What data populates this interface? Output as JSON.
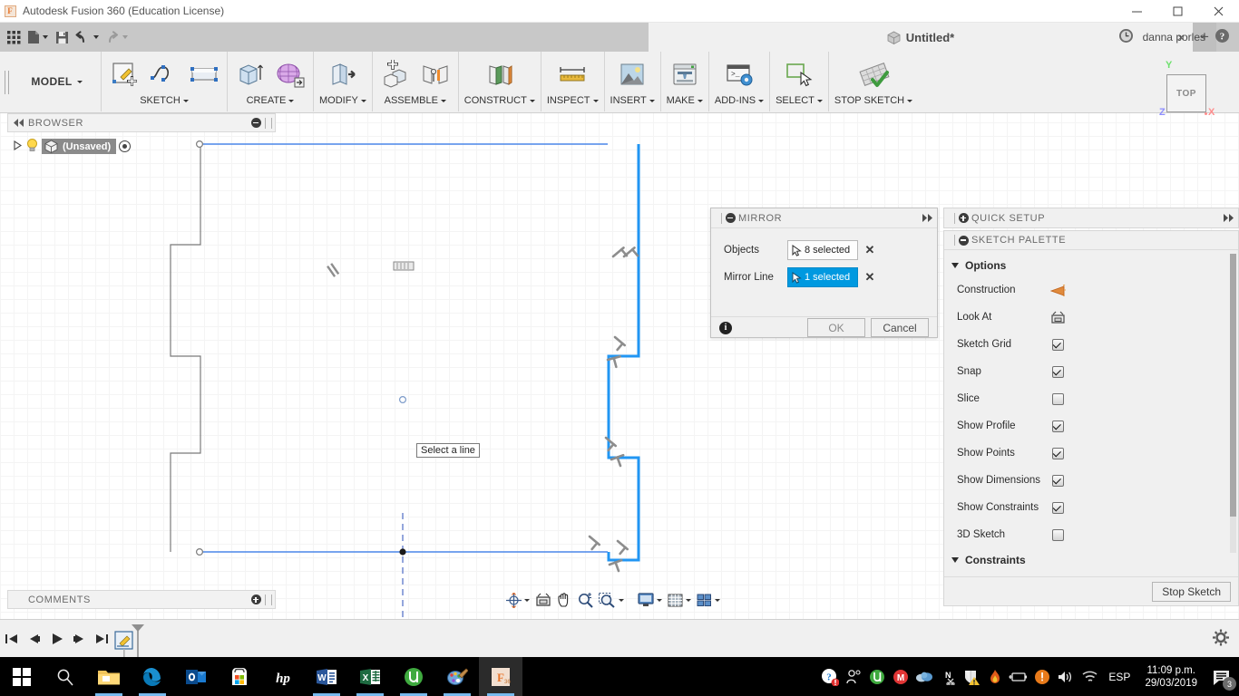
{
  "window": {
    "app_title": "Autodesk Fusion 360 (Education License)",
    "logo_glyph": "F",
    "minimize_icon": "minimize-icon",
    "maximize_icon": "maximize-icon",
    "close_icon": "close-icon"
  },
  "quick_access": {
    "grid_icon": "app-grid-icon",
    "new_icon": "new-document-icon",
    "save_icon": "save-icon",
    "undo_icon": "undo-icon",
    "redo_icon": "redo-icon",
    "document_tab": "Untitled*",
    "document_icon": "cube-icon",
    "tab_close": "×",
    "tab_new": "+",
    "recent_icon": "clock-icon",
    "username": "danna porles",
    "help_icon": "help-icon"
  },
  "ribbon": {
    "workspace": "MODEL",
    "groups": [
      {
        "label": "SKETCH",
        "icons": [
          "create-sketch-icon",
          "spline-icon",
          "rectangle-icon"
        ]
      },
      {
        "label": "CREATE",
        "icons": [
          "extrude-icon",
          "create-form-icon"
        ]
      },
      {
        "label": "MODIFY",
        "icons": [
          "press-pull-icon"
        ]
      },
      {
        "label": "ASSEMBLE",
        "icons": [
          "new-component-icon",
          "joint-icon"
        ]
      },
      {
        "label": "CONSTRUCT",
        "icons": [
          "offset-plane-icon"
        ]
      },
      {
        "label": "INSPECT",
        "icons": [
          "measure-icon"
        ]
      },
      {
        "label": "INSERT",
        "icons": [
          "insert-image-icon"
        ]
      },
      {
        "label": "MAKE",
        "icons": [
          "3d-print-icon"
        ]
      },
      {
        "label": "ADD-INS",
        "icons": [
          "scripts-addins-icon"
        ]
      },
      {
        "label": "SELECT",
        "icons": [
          "select-icon"
        ]
      },
      {
        "label": "STOP SKETCH",
        "icons": [
          "stop-sketch-icon"
        ]
      }
    ]
  },
  "browser": {
    "title": "BROWSER",
    "collapse_icon": "collapse-left-icon",
    "minus_icon": "minus-circle-icon",
    "root": {
      "expand_icon": "triangle-right-icon",
      "bulb_icon": "lightbulb-icon",
      "component_icon": "component-icon",
      "label": "(Unsaved)",
      "radio_icon": "radio-selected-icon"
    }
  },
  "comments": {
    "title": "COMMENTS",
    "plus_icon": "plus-circle-icon"
  },
  "viewcube": {
    "face_label": "TOP",
    "axis_y": "Y",
    "axis_x": "X",
    "axis_z": "Z"
  },
  "canvas": {
    "tooltip": "Select a line",
    "grid_minor_color": "#f4f4f4",
    "grid_major_color": "#dcdcdc",
    "selection_color": "#2196f3",
    "profile_color": "#4a86e8",
    "geometry_color": "#7b7b7b",
    "construction_color": "#5b77c9"
  },
  "mirror_dialog": {
    "title": "MIRROR",
    "grip_icon": "drag-grip-icon",
    "minimize_icon": "minus-circle-icon",
    "expand_icon": "expand-right-icon",
    "rows": [
      {
        "label": "Objects",
        "value": "8 selected",
        "cursor_icon": "select-cursor-icon",
        "clear_icon": "✕",
        "active": false
      },
      {
        "label": "Mirror Line",
        "value": "1 selected",
        "cursor_icon": "select-cursor-icon",
        "clear_icon": "✕",
        "active": true
      }
    ],
    "info_icon": "info-icon",
    "ok_label": "OK",
    "cancel_label": "Cancel"
  },
  "quick_setup": {
    "title": "QUICK SETUP",
    "plus_icon": "plus-circle-icon",
    "expand_icon": "expand-right-icon",
    "grip_icon": "drag-grip-icon"
  },
  "sketch_palette": {
    "title": "SKETCH PALETTE",
    "minimize_icon": "minus-circle-icon",
    "grip_icon": "drag-grip-icon",
    "options_section": "Options",
    "constraints_section": "Constraints",
    "options": [
      {
        "label": "Construction",
        "control": "icon",
        "icon": "construction-line-icon",
        "checked": null
      },
      {
        "label": "Look At",
        "control": "icon",
        "icon": "look-at-icon",
        "checked": null
      },
      {
        "label": "Sketch Grid",
        "control": "checkbox",
        "icon": "checkbox-icon",
        "checked": true
      },
      {
        "label": "Snap",
        "control": "checkbox",
        "icon": "checkbox-icon",
        "checked": true
      },
      {
        "label": "Slice",
        "control": "checkbox",
        "icon": "checkbox-icon",
        "checked": false
      },
      {
        "label": "Show Profile",
        "control": "checkbox",
        "icon": "checkbox-icon",
        "checked": true
      },
      {
        "label": "Show Points",
        "control": "checkbox",
        "icon": "checkbox-icon",
        "checked": true
      },
      {
        "label": "Show Dimensions",
        "control": "checkbox",
        "icon": "checkbox-icon",
        "checked": true
      },
      {
        "label": "Show Constraints",
        "control": "checkbox",
        "icon": "checkbox-icon",
        "checked": true
      },
      {
        "label": "3D Sketch",
        "control": "checkbox",
        "icon": "checkbox-icon",
        "checked": false
      }
    ],
    "stop_sketch_label": "Stop Sketch"
  },
  "nav_bar": {
    "items": [
      {
        "icon": "orbit-icon",
        "has_caret": true
      },
      {
        "icon": "look-at-icon",
        "has_caret": false
      },
      {
        "icon": "pan-icon",
        "has_caret": false
      },
      {
        "icon": "zoom-icon",
        "has_caret": false
      },
      {
        "icon": "zoom-window-icon",
        "has_caret": true
      },
      {
        "icon": "display-settings-icon",
        "has_caret": true
      },
      {
        "icon": "grid-snaps-icon",
        "has_caret": true
      },
      {
        "icon": "viewports-icon",
        "has_caret": true
      }
    ]
  },
  "timeline": {
    "buttons": [
      {
        "icon": "go-to-beginning-icon"
      },
      {
        "icon": "step-back-icon"
      },
      {
        "icon": "play-icon"
      },
      {
        "icon": "step-forward-icon"
      },
      {
        "icon": "go-to-end-icon"
      }
    ],
    "feature_icon": "sketch-feature-icon",
    "settings_icon": "gear-icon"
  },
  "taskbar": {
    "start_icon": "windows-start-icon",
    "search_icon": "search-icon",
    "items": [
      {
        "icon": "file-explorer-icon",
        "open": true,
        "active": false
      },
      {
        "icon": "edge-icon",
        "open": true,
        "active": false
      },
      {
        "icon": "outlook-icon",
        "open": false,
        "active": false
      },
      {
        "icon": "microsoft-store-icon",
        "open": false,
        "active": false
      },
      {
        "icon": "hp-icon",
        "open": false,
        "active": false
      },
      {
        "icon": "word-icon",
        "open": true,
        "active": false
      },
      {
        "icon": "excel-icon",
        "open": true,
        "active": false
      },
      {
        "icon": "utorrent-icon",
        "open": true,
        "active": false
      },
      {
        "icon": "paint-icon",
        "open": true,
        "active": false
      },
      {
        "icon": "fusion360-icon",
        "open": true,
        "active": true
      }
    ],
    "tray": [
      {
        "icon": "help-alert-icon"
      },
      {
        "icon": "people-icon"
      },
      {
        "icon": "utorrent-tray-icon"
      },
      {
        "icon": "mega-icon"
      },
      {
        "icon": "onedrive-icon"
      },
      {
        "icon": "nvidia-snip-icon"
      },
      {
        "icon": "security-warning-icon"
      },
      {
        "icon": "firewall-icon"
      },
      {
        "icon": "battery-icon"
      },
      {
        "icon": "alert-icon"
      },
      {
        "icon": "volume-icon"
      },
      {
        "icon": "wifi-icon"
      }
    ],
    "language": "ESP",
    "clock_time": "11:09 p.m.",
    "clock_date": "29/03/2019",
    "notification_icon": "notifications-icon",
    "notification_count": "3"
  }
}
